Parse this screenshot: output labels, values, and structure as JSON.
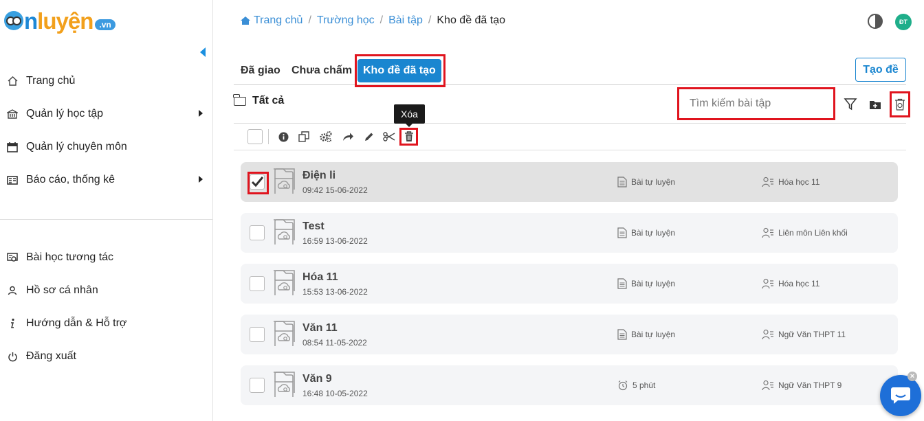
{
  "logo": {
    "brand_o": "",
    "brand_n": "n",
    "brand_rest": "luyện",
    "tld": ".vn"
  },
  "sidebar": {
    "items": [
      {
        "label": "Trang chủ",
        "icon": "home-icon"
      },
      {
        "label": "Quản lý học tập",
        "icon": "school-icon",
        "has_submenu": true
      },
      {
        "label": "Quản lý chuyên môn",
        "icon": "calendar-icon"
      },
      {
        "label": "Báo cáo, thống kê",
        "icon": "report-icon",
        "has_submenu": true
      },
      {
        "label": "Bài học tương tác",
        "icon": "interactive-lesson-icon"
      },
      {
        "label": "Hồ sơ cá nhân",
        "icon": "user-icon"
      },
      {
        "label": "Hướng dẫn & Hỗ trợ",
        "icon": "info-icon"
      },
      {
        "label": "Đăng xuất",
        "icon": "logout-icon"
      }
    ]
  },
  "breadcrumb": {
    "items": [
      "Trang chủ",
      "Trường học",
      "Bài tập"
    ],
    "current": "Kho đề đã tạo"
  },
  "header": {
    "avatar_initials": "ĐT"
  },
  "tabs": [
    "Đã giao",
    "Chưa chấm",
    "Kho đề đã tạo"
  ],
  "active_tab": "Kho đề đã tạo",
  "create_button": "Tạo đề",
  "folder": {
    "label": "Tất cả"
  },
  "search": {
    "placeholder": "Tìm kiếm bài tập",
    "value": ""
  },
  "tooltip": "Xóa",
  "accent_color": "#1a86d0",
  "highlight_color": "#e0141e",
  "exercises": [
    {
      "title": "Điện li",
      "date": "09:42 15-06-2022",
      "type": "Bài tự luyện",
      "type_icon": "document-icon",
      "target": "Hóa học 11",
      "checked": true
    },
    {
      "title": "Test",
      "date": "16:59 13-06-2022",
      "type": "Bài tự luyện",
      "type_icon": "document-icon",
      "target": "Liên môn Liên khối",
      "checked": false
    },
    {
      "title": "Hóa 11",
      "date": "15:53 13-06-2022",
      "type": "Bài tự luyện",
      "type_icon": "document-icon",
      "target": "Hóa học 11",
      "checked": false
    },
    {
      "title": "Văn 11",
      "date": "08:54 11-05-2022",
      "type": "Bài tự luyện",
      "type_icon": "document-icon",
      "target": "Ngữ Văn THPT 11",
      "checked": false
    },
    {
      "title": "Văn 9",
      "date": "16:48 10-05-2022",
      "type": "5 phút",
      "type_icon": "alarm-clock-icon",
      "target": "Ngữ Văn THPT 9",
      "checked": false
    }
  ]
}
